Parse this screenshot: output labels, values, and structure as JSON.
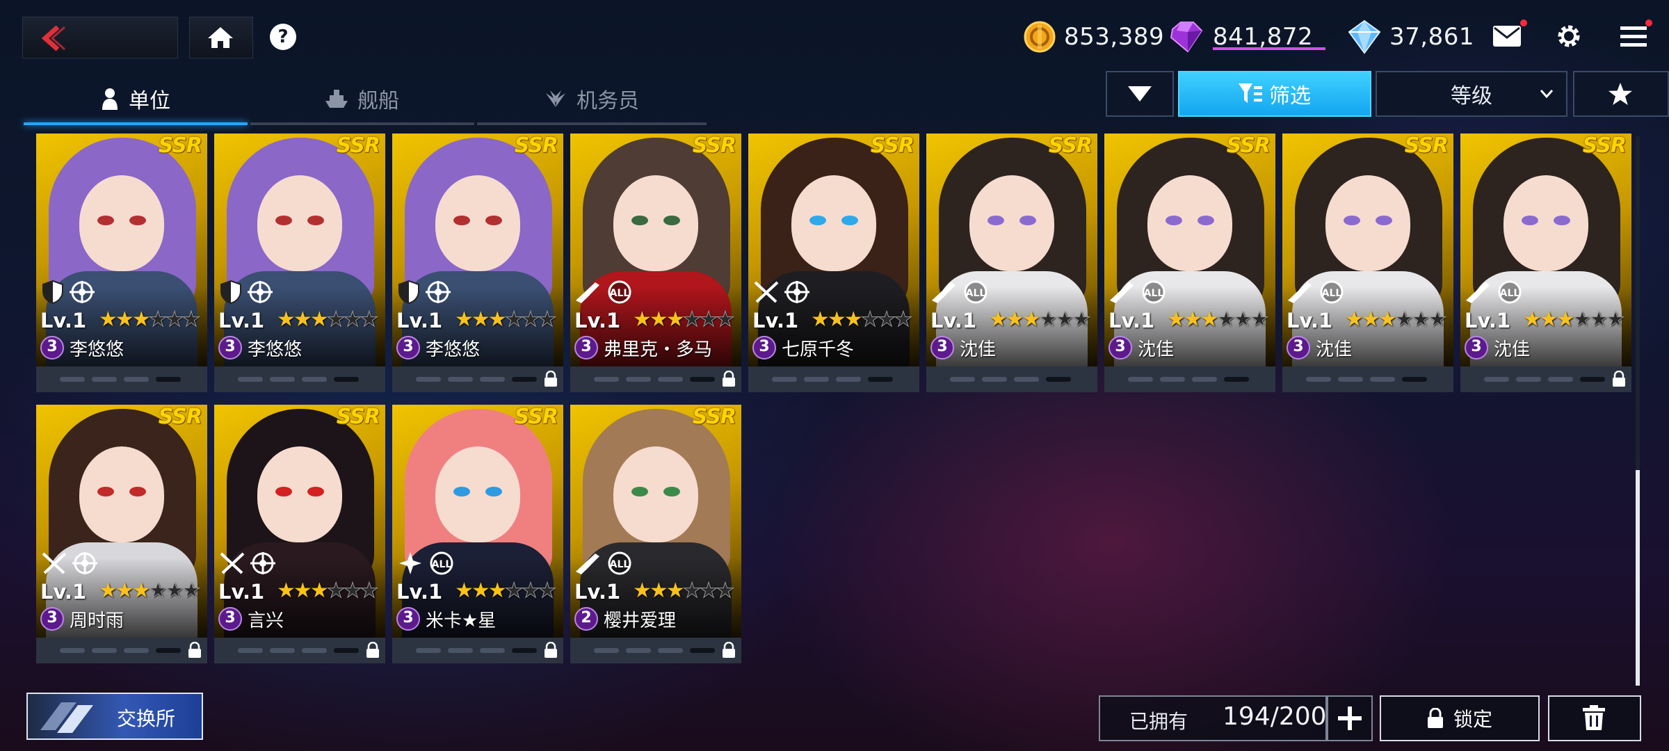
{
  "header": {
    "currencies": [
      {
        "name": "gold-coin-icon",
        "value": "853,389",
        "color": "#f3a51c"
      },
      {
        "name": "purple-gem-icon",
        "value": "841,872",
        "color": "#b04ae0"
      },
      {
        "name": "blue-crystal-icon",
        "value": "37,861",
        "color": "#7bc6ff"
      }
    ],
    "help_label": "?"
  },
  "tabs": [
    {
      "label": "单位",
      "icon": "person-icon",
      "active": true
    },
    {
      "label": "舰船",
      "icon": "ship-icon",
      "active": false
    },
    {
      "label": "机务员",
      "icon": "wings-icon",
      "active": false
    }
  ],
  "filters": {
    "filter_label": "筛选",
    "sort_label": "等级"
  },
  "accent_color": "#22a8ff",
  "cards": [
    {
      "rarity": "SSR",
      "level": "Lv.1",
      "stars": 3,
      "max_stars": 6,
      "rank": "3",
      "name": "李悠悠",
      "roles": [
        "shield-icon",
        "targeting-icon"
      ],
      "locked": false,
      "art": {
        "hair": "#8b67c8",
        "eye": "#b33030",
        "body": "#3a4f72"
      }
    },
    {
      "rarity": "SSR",
      "level": "Lv.1",
      "stars": 3,
      "max_stars": 6,
      "rank": "3",
      "name": "李悠悠",
      "roles": [
        "shield-icon",
        "targeting-icon"
      ],
      "locked": false,
      "art": {
        "hair": "#8b67c8",
        "eye": "#b33030",
        "body": "#3a4f72"
      }
    },
    {
      "rarity": "SSR",
      "level": "Lv.1",
      "stars": 3,
      "max_stars": 6,
      "rank": "3",
      "name": "李悠悠",
      "roles": [
        "shield-icon",
        "targeting-icon"
      ],
      "locked": true,
      "art": {
        "hair": "#8b67c8",
        "eye": "#b33030",
        "body": "#3a4f72"
      }
    },
    {
      "rarity": "SSR",
      "level": "Lv.1",
      "stars": 3,
      "max_stars": 6,
      "rank": "3",
      "name": "弗里克・多马",
      "roles": [
        "rifle-icon",
        "all-target-icon"
      ],
      "locked": true,
      "art": {
        "hair": "#4e3c35",
        "eye": "#3a6a40",
        "body": "#b0161c"
      }
    },
    {
      "rarity": "SSR",
      "level": "Lv.1",
      "stars": 3,
      "max_stars": 6,
      "rank": "3",
      "name": "七原千冬",
      "roles": [
        "crossed-swords-icon",
        "targeting-icon"
      ],
      "locked": false,
      "art": {
        "hair": "#3a2218",
        "eye": "#2fa9e8",
        "body": "#1e1e22"
      }
    },
    {
      "rarity": "SSR",
      "level": "Lv.1",
      "stars": 3,
      "max_stars": 6,
      "rank": "3",
      "name": "沈佳",
      "roles": [
        "rifle-icon",
        "all-target-icon"
      ],
      "locked": false,
      "art": {
        "hair": "#2d2420",
        "eye": "#8b6ad0",
        "body": "#e8e8ea"
      }
    },
    {
      "rarity": "SSR",
      "level": "Lv.1",
      "stars": 3,
      "max_stars": 6,
      "rank": "3",
      "name": "沈佳",
      "roles": [
        "rifle-icon",
        "all-target-icon"
      ],
      "locked": false,
      "art": {
        "hair": "#2d2420",
        "eye": "#8b6ad0",
        "body": "#e8e8ea"
      }
    },
    {
      "rarity": "SSR",
      "level": "Lv.1",
      "stars": 3,
      "max_stars": 6,
      "rank": "3",
      "name": "沈佳",
      "roles": [
        "rifle-icon",
        "all-target-icon"
      ],
      "locked": false,
      "art": {
        "hair": "#2d2420",
        "eye": "#8b6ad0",
        "body": "#e8e8ea"
      }
    },
    {
      "rarity": "SSR",
      "level": "Lv.1",
      "stars": 3,
      "max_stars": 6,
      "rank": "3",
      "name": "沈佳",
      "roles": [
        "rifle-icon",
        "all-target-icon"
      ],
      "locked": true,
      "art": {
        "hair": "#2d2420",
        "eye": "#8b6ad0",
        "body": "#e8e8ea"
      }
    },
    {
      "rarity": "SSR",
      "level": "Lv.1",
      "stars": 3,
      "max_stars": 6,
      "rank": "3",
      "name": "周时雨",
      "roles": [
        "crossed-swords-icon",
        "targeting-icon"
      ],
      "locked": true,
      "art": {
        "hair": "#3a241c",
        "eye": "#c22a2a",
        "body": "#d8d8dc"
      }
    },
    {
      "rarity": "SSR",
      "level": "Lv.1",
      "stars": 3,
      "max_stars": 6,
      "rank": "3",
      "name": "言兴",
      "roles": [
        "crossed-swords-icon",
        "targeting-icon"
      ],
      "locked": true,
      "art": {
        "hair": "#1c1418",
        "eye": "#d42020",
        "body": "#2a1a20"
      }
    },
    {
      "rarity": "SSR",
      "level": "Lv.1",
      "stars": 3,
      "max_stars": 6,
      "rank": "3",
      "name": "米卡★星",
      "roles": [
        "sparkle-icon",
        "all-target-icon"
      ],
      "locked": true,
      "art": {
        "hair": "#f08080",
        "eye": "#2e9be0",
        "body": "#1c2036"
      }
    },
    {
      "rarity": "SSR",
      "level": "Lv.1",
      "stars": 3,
      "max_stars": 6,
      "rank": "2",
      "name": "樱井爱理",
      "roles": [
        "rifle-icon",
        "all-target-icon"
      ],
      "locked": true,
      "art": {
        "hair": "#a27a56",
        "eye": "#3c8a4a",
        "body": "#2a2a2e"
      }
    }
  ],
  "bottom": {
    "exchange_label": "交换所",
    "owned_label": "已拥有",
    "owned_count": "194/200",
    "lock_label": "锁定"
  }
}
